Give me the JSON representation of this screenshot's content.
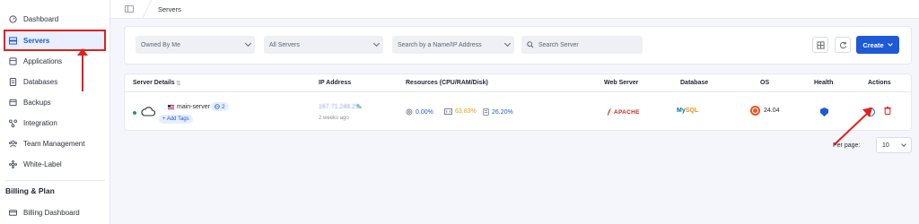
{
  "sidebar": {
    "items": [
      {
        "label": "Dashboard",
        "icon": "dashboard-icon"
      },
      {
        "label": "Servers",
        "icon": "servers-icon",
        "active": true
      },
      {
        "label": "Applications",
        "icon": "applications-icon"
      },
      {
        "label": "Databases",
        "icon": "databases-icon"
      },
      {
        "label": "Backups",
        "icon": "backups-icon"
      },
      {
        "label": "Integration",
        "icon": "integration-icon"
      },
      {
        "label": "Team Management",
        "icon": "team-icon"
      },
      {
        "label": "White-Label",
        "icon": "white-label-icon"
      }
    ],
    "section_title": "Billing & Plan",
    "billing_items": [
      {
        "label": "Billing Dashboard",
        "icon": "billing-icon"
      }
    ]
  },
  "breadcrumb": {
    "current": "Servers"
  },
  "filters": {
    "owned_by": "Owned By Me",
    "server_filter": "All Servers",
    "search_by": "Search by a Name/IP Address",
    "search_placeholder": "Search Server",
    "create_label": "Create"
  },
  "table": {
    "headers": {
      "server_details": "Server Details",
      "ip_address": "IP Address",
      "resources": "Resources (CPU/RAM/Disk)",
      "web_server": "Web Server",
      "database": "Database",
      "os": "OS",
      "health": "Health",
      "actions": "Actions"
    },
    "rows": [
      {
        "name": "main-server",
        "site_count": "2",
        "add_tags": "+ Add Tags",
        "ip": "167.71.249.25",
        "created": "2 weeks ago",
        "cpu": "0.00%",
        "ram": "63.83%",
        "disk": "26.20%",
        "web_server": "APACHE",
        "database_my": "My",
        "database_sql": "SQL",
        "os_version": "24.04",
        "status_color": "#1f9d55"
      }
    ]
  },
  "pagination": {
    "label": "Per page:",
    "value": "10"
  },
  "colors": {
    "accent": "#1e5ad8",
    "annotation": "#e2201c",
    "cpu": "#1e5ad8",
    "ram": "#e7a21a",
    "disk": "#1e5ad8"
  }
}
